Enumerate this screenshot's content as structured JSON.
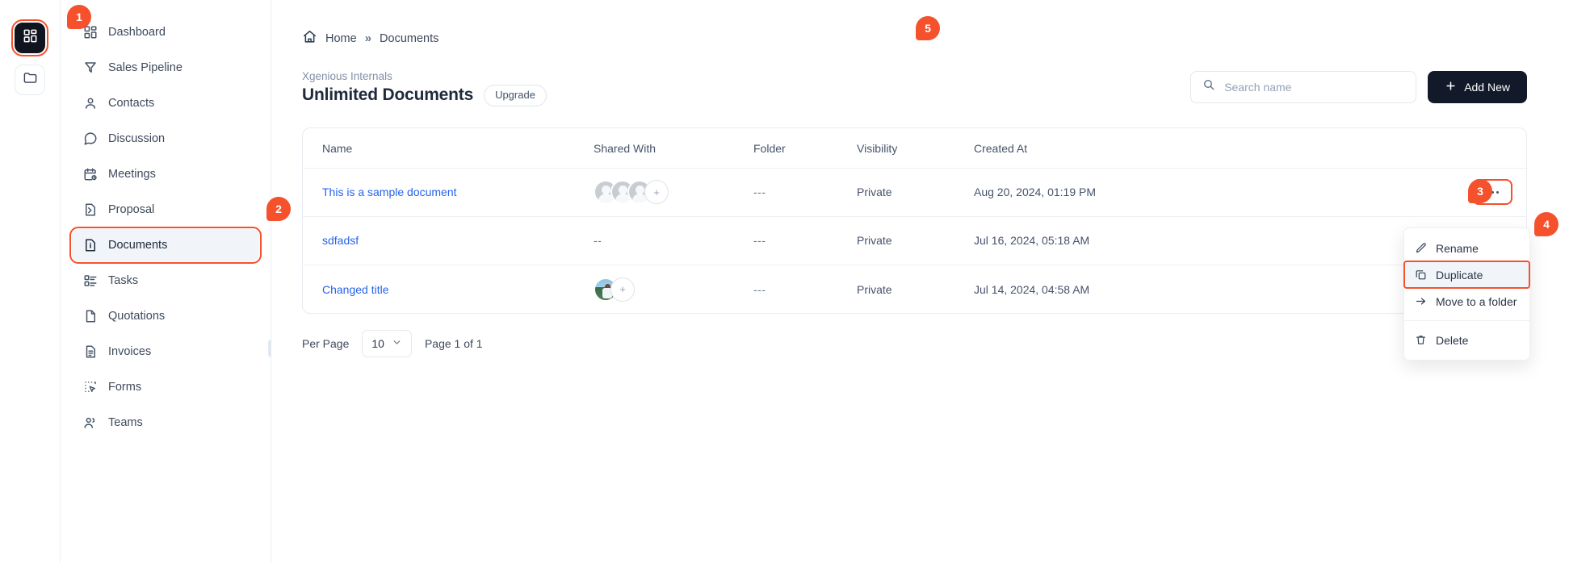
{
  "colors": {
    "accent": "#f4512c",
    "link": "#2563eb",
    "dark_button": "#121a2a",
    "active_nav_bg": "#f1f5f9"
  },
  "rail": {
    "items": [
      {
        "icon": "grid-apps-icon",
        "name": "apps",
        "active": true
      },
      {
        "icon": "folder-icon",
        "name": "folders",
        "active": false
      }
    ]
  },
  "sidebar": {
    "items": [
      {
        "label": "Dashboard",
        "icon": "dashboard-icon"
      },
      {
        "label": "Sales Pipeline",
        "icon": "funnel-icon"
      },
      {
        "label": "Contacts",
        "icon": "user-icon"
      },
      {
        "label": "Discussion",
        "icon": "chat-bubble-icon"
      },
      {
        "label": "Meetings",
        "icon": "calendar-clock-icon"
      },
      {
        "label": "Proposal",
        "icon": "file-signature-icon"
      },
      {
        "label": "Documents",
        "icon": "file-info-icon"
      },
      {
        "label": "Tasks",
        "icon": "list-checks-icon"
      },
      {
        "label": "Quotations",
        "icon": "file-icon"
      },
      {
        "label": "Invoices",
        "icon": "file-lines-icon"
      },
      {
        "label": "Forms",
        "icon": "form-pointer-icon"
      },
      {
        "label": "Teams",
        "icon": "users-icon"
      }
    ],
    "active_label": "Documents"
  },
  "breadcrumb": {
    "home_icon": "home-icon",
    "home": "Home",
    "separator": "»",
    "current": "Documents"
  },
  "header": {
    "eyebrow": "Xgenious Internals",
    "title": "Unlimited Documents",
    "upgrade_label": "Upgrade",
    "search": {
      "icon": "search-icon",
      "placeholder": "Search name",
      "value": ""
    },
    "add_new": {
      "icon": "plus-icon",
      "label": "Add New"
    }
  },
  "table": {
    "columns": [
      "Name",
      "Shared With",
      "Folder",
      "Visibility",
      "Created At"
    ],
    "rows": [
      {
        "name": "This is a sample document",
        "shared_with": "avatars-3-plus",
        "folder": "---",
        "visibility": "Private",
        "created_at": "Aug 20, 2024, 01:19 PM",
        "actions_icon": "ellipsis-icon"
      },
      {
        "name": "sdfadsf",
        "shared_with": "--",
        "folder": "---",
        "visibility": "Private",
        "created_at": "Jul 16, 2024, 05:18 AM",
        "actions_icon": "ellipsis-icon"
      },
      {
        "name": "Changed title",
        "shared_with": "avatar-photo-plus",
        "folder": "---",
        "visibility": "Private",
        "created_at": "Jul 14, 2024, 04:58 AM",
        "actions_icon": "ellipsis-icon"
      }
    ]
  },
  "context_menu": {
    "items": [
      {
        "label": "Rename",
        "icon": "pencil-icon",
        "highlighted": false
      },
      {
        "label": "Duplicate",
        "icon": "copy-icon",
        "highlighted": true
      },
      {
        "label": "Move to a folder",
        "icon": "arrow-right-icon",
        "highlighted": false
      },
      {
        "label": "Delete",
        "icon": "trash-icon",
        "highlighted": false
      }
    ]
  },
  "footer": {
    "per_page_label": "Per Page",
    "per_page_value": "10",
    "page_info": "Page 1 of 1",
    "prev_icon": "chevron-left-icon",
    "next_icon": "chevron-right-icon"
  },
  "markers": [
    {
      "id": "1",
      "label": "1"
    },
    {
      "id": "2",
      "label": "2"
    },
    {
      "id": "3",
      "label": "3"
    },
    {
      "id": "4",
      "label": "4"
    },
    {
      "id": "5",
      "label": "5"
    }
  ]
}
